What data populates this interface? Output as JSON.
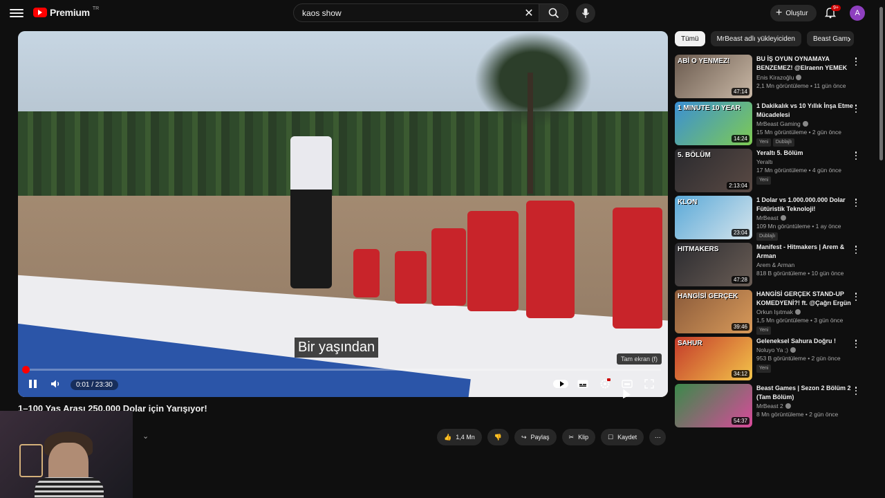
{
  "header": {
    "logo_text": "Premium",
    "logo_country": "TR",
    "search_value": "kaos show",
    "create_label": "Oluştur",
    "notification_badge": "9+",
    "avatar_letter": "A"
  },
  "player": {
    "subtitle": "Bir yaşından",
    "tooltip": "Tam ekran (f)",
    "time_label": "0:01 / 23:30",
    "progress": 0.0007,
    "title": "1–100 Yaş Arası 250.000 Dolar için Yarışıyor!",
    "like_count": "1,4 Mn",
    "share_label": "Paylaş",
    "clip_label": "Klip",
    "save_label": "Kaydet"
  },
  "chips": [
    {
      "label": "Tümü",
      "active": true
    },
    {
      "label": "MrBeast adlı yükleyiciden"
    },
    {
      "label": "Beast Gam"
    }
  ],
  "recommendations": [
    {
      "title": "BU İŞ OYUN OYNAMAYA BENZEMEZ! @Elraenn YEMEK ...",
      "channel": "Enis Kirazoğlu",
      "verified": true,
      "stats": "2,1 Mn görüntüleme • 11 gün önce",
      "duration": "47:14",
      "caption": "ABİ O YENMEZ!",
      "tags": [],
      "colors": [
        "#6a5a4e",
        "#c9b8a6"
      ]
    },
    {
      "title": "1 Dakikalık vs 10 Yıllık İnşa Etme Mücadelesi",
      "channel": "MrBeast Gaming",
      "verified": true,
      "stats": "15 Mn görüntüleme • 2 gün önce",
      "duration": "14:24",
      "caption": "1 MINUTE        10 YEAR",
      "tags": [
        "Yeni",
        "Dublajlı"
      ],
      "colors": [
        "#3b8fd4",
        "#7ecb52"
      ]
    },
    {
      "title": "Yeraltı 5. Bölüm",
      "channel": "Yeraltı",
      "verified": false,
      "stats": "17 Mn görüntüleme • 4 gün önce",
      "duration": "2:13:04",
      "caption": "5. BÖLÜM",
      "tags": [
        "Yeni"
      ],
      "colors": [
        "#2a2a2e",
        "#5a4a44"
      ]
    },
    {
      "title": "1 Dolar vs 1.000.000.000 Dolar Fütüristik Teknoloji!",
      "channel": "MrBeast",
      "verified": true,
      "stats": "109 Mn görüntüleme • 1 ay önce",
      "duration": "23:04",
      "caption": "KLON",
      "tags": [
        "Dublajlı"
      ],
      "colors": [
        "#5aa9d8",
        "#d5e4ec"
      ]
    },
    {
      "title": "Manifest - Hitmakers | Arem & Arman",
      "channel": "Arem & Arman",
      "verified": false,
      "stats": "818 B görüntüleme • 10 gün önce",
      "duration": "47:28",
      "caption": "HITMAKERS",
      "tags": [],
      "colors": [
        "#2c2c30",
        "#6a5d55"
      ]
    },
    {
      "title": "HANGİSİ GERÇEK STAND-UP KOMEDYENİ?! ft. @Çağrı Ergün",
      "channel": "Orkun Işıtmak",
      "verified": true,
      "stats": "1,5 Mn görüntüleme • 3 gün önce",
      "duration": "39:46",
      "caption": "HANGİSİ GERÇEK",
      "tags": [
        "Yeni"
      ],
      "colors": [
        "#8a5a3a",
        "#d89a5a"
      ]
    },
    {
      "title": "Geleneksel Sahura Doğru !",
      "channel": "Noluyo Ya ;)",
      "verified": true,
      "stats": "953 B görüntüleme • 2 gün önce",
      "duration": "34:12",
      "caption": "SAHUR",
      "tags": [
        "Yeni"
      ],
      "colors": [
        "#c43a2a",
        "#f3c44a"
      ]
    },
    {
      "title": "Beast Games | Sezon 2 Bölüm 2 (Tam Bölüm)",
      "channel": "MrBeast 2",
      "verified": true,
      "stats": "8 Mn görüntüleme • 2 gün önce",
      "duration": "54:37",
      "caption": "",
      "tags": [],
      "colors": [
        "#3a8a4a",
        "#d84a9a"
      ]
    }
  ]
}
